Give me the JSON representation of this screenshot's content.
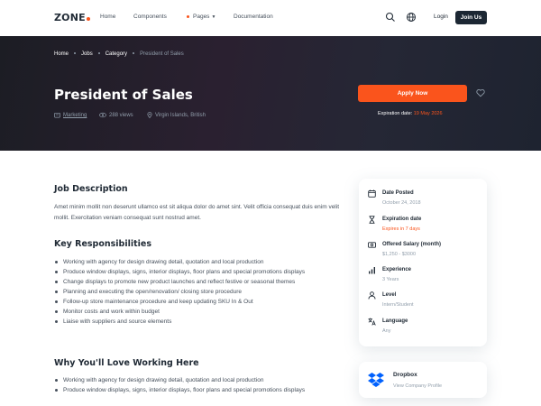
{
  "header": {
    "logo": "ZONE",
    "nav": [
      "Home",
      "Components",
      "Pages",
      "Documentation"
    ],
    "login": "Login",
    "join": "Join Us"
  },
  "hero": {
    "breadcrumbs": [
      "Home",
      "Jobs",
      "Category",
      "President of Sales"
    ],
    "title": "President of Sales",
    "category": "Marketing",
    "views": "288 views",
    "location": "Virgin Islands, British",
    "apply": "Apply Now",
    "expiration_label": "Expiration date:",
    "expiration_date": "19 May 2026"
  },
  "main": {
    "description_title": "Job Description",
    "description": "Amet minim mollit non deserunt ullamco est sit aliqua dolor do amet sint. Velit officia consequat duis enim velit mollit. Exercitation veniam consequat sunt nostrud amet.",
    "responsibilities_title": "Key Responsibilities",
    "responsibilities": [
      "Working with agency for design drawing detail, quotation and local production",
      "Produce window displays, signs, interior displays, floor plans and special promotions displays",
      "Change displays to promote new product launches and reflect festive or seasonal themes",
      "Planning and executing the open/renovation/ closing store procedure",
      "Follow-up store maintenance procedure and keep updating SKU In & Out",
      "Monitor costs and work within budget",
      "Liaise with suppliers and source elements"
    ],
    "love_title": "Why You'll Love Working Here",
    "love": [
      "Working with agency for design drawing detail, quotation and local production",
      "Produce window displays, signs, interior displays, floor plans and special promotions displays"
    ]
  },
  "sidebar": {
    "items": [
      {
        "label": "Date Posted",
        "value": "October 24, 2018"
      },
      {
        "label": "Expiration date",
        "value": "Expires in 7 days"
      },
      {
        "label": "Offered Salary (month)",
        "value": "$1,250 - $3000"
      },
      {
        "label": "Experience",
        "value": "3 Years"
      },
      {
        "label": "Level",
        "value": "Intern/Student"
      },
      {
        "label": "Language",
        "value": "Any"
      }
    ],
    "company": {
      "name": "Dropbox",
      "link": "View Company Profile"
    }
  },
  "colors": {
    "accent": "#fa541c",
    "dark": "#1c2733",
    "hero_bg": "#1f1f28"
  }
}
